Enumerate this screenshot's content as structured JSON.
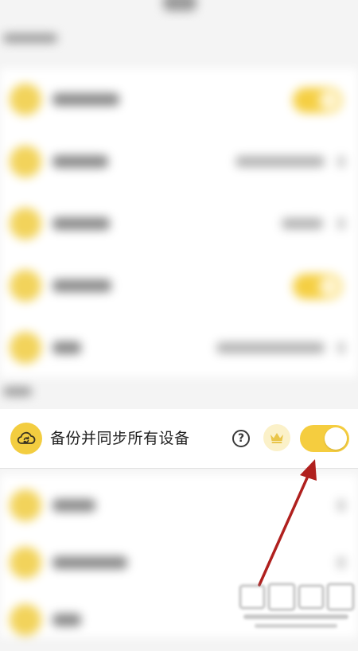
{
  "backup_row": {
    "label": "备份并同步所有设备",
    "help_glyph": "?",
    "icon": "cloud-sync-icon",
    "badge_icon": "crown-icon",
    "toggle_on": true
  },
  "colors": {
    "accent_yellow": "#f5cd3f",
    "icon_yellow": "#f3cd40",
    "crown_bg": "#fbf1c9",
    "crown": "#e9c54a",
    "arrow_red": "#b0201e",
    "page_bg": "#f4f4f4"
  }
}
